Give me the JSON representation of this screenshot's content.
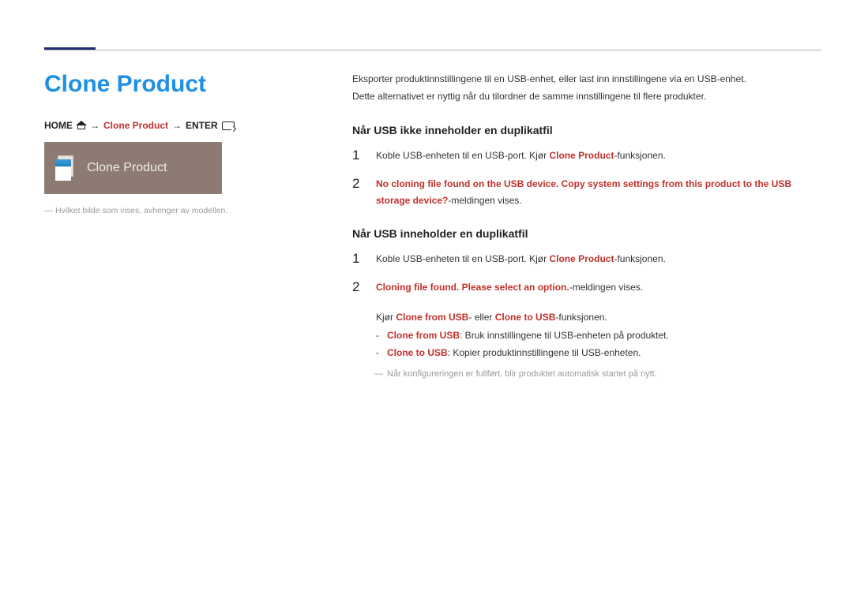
{
  "title": "Clone Product",
  "breadcrumb": {
    "home": "HOME",
    "arrow": "→",
    "product": "Clone Product",
    "enter": "ENTER"
  },
  "tile": {
    "label": "Clone Product"
  },
  "footnote": "Hvilket bilde som vises, avhenger av modellen.",
  "intro": {
    "line1": "Eksporter produktinnstillingene til en USB-enhet, eller last inn innstillingene via en USB-enhet.",
    "line2": "Dette alternativet er nyttig når du tilordner de samme innstillingene til flere produkter."
  },
  "section1": {
    "heading": "Når USB ikke inneholder en duplikatfil",
    "step1": {
      "num": "1",
      "pre": "Koble USB-enheten til en USB-port. Kjør ",
      "bold": "Clone Product",
      "post": "-funksjonen."
    },
    "step2": {
      "num": "2",
      "red": "No cloning file found on the USB device. Copy system settings from this product to the USB storage device?",
      "dash": "-",
      "post": "meldingen vises."
    }
  },
  "section2": {
    "heading": "Når USB inneholder en duplikatfil",
    "step1": {
      "num": "1",
      "pre": "Koble USB-enheten til en USB-port. Kjør ",
      "bold": "Clone Product",
      "post": "-funksjonen."
    },
    "step2": {
      "num": "2",
      "red": "Cloning file found. Please select an option.",
      "post": "-meldingen vises."
    },
    "run": {
      "pre": "Kjør ",
      "a": "Clone from USB",
      "mid": "- eller ",
      "b": "Clone to USB",
      "post": "-funksjonen."
    },
    "bullet1": {
      "label": "Clone from USB",
      "text": ": Bruk innstillingene til USB-enheten på produktet."
    },
    "bullet2": {
      "label": "Clone to USB",
      "text": ": Kopier produktinnstillingene til USB-enheten."
    },
    "note": "Når konfigureringen er fullført, blir produktet automatisk startet på nytt."
  }
}
